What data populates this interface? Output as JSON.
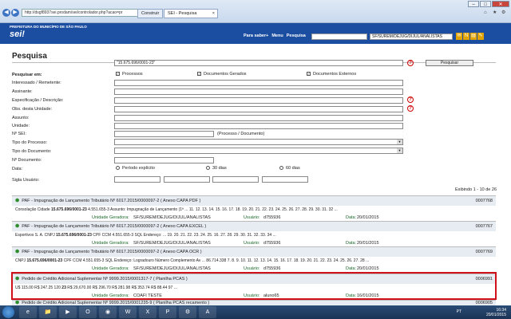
{
  "browser": {
    "url": "http://dsgf8937sei.prodam/sei/controlador.php?acao=pr",
    "tab1": "Construir",
    "tab2": "SEI - Pesquisa",
    "tab_close": "×",
    "back_glyph": "◀",
    "fwd_glyph": "▶",
    "home_glyph": "⌂",
    "star_glyph": "★",
    "gear_glyph": "⚙",
    "min": "–",
    "max": "□",
    "close": "✕"
  },
  "header": {
    "prefeitura": "PREFEITURA DO MUNICÍPIO DE SÃO PAULO",
    "logo": "sei!",
    "para_saber": "Para saber+",
    "menu": "Menu",
    "pesquisa": "Pesquisa",
    "unit": "SF/SUREM/DEJUG/DIJUL/ANALISTAS",
    "icons": [
      "✉",
      "N",
      "▤",
      "✎"
    ]
  },
  "page": {
    "title": "Pesquisa",
    "search_value": "\"15.675.696/0001-23\"",
    "search_button": "Pesquisar",
    "help": "?",
    "check": "✓"
  },
  "form": {
    "pesquisar_em": "Pesquisar em:",
    "processos": "Processos",
    "docs_gerados": "Documentos Gerados",
    "docs_externos": "Documentos Externos",
    "interessado": "Interessado / Remetente:",
    "assinante": "Assinante:",
    "especificacao": "Especificação / Descrição:",
    "obs": "Obs. desta Unidade:",
    "assunto": "Assunto:",
    "unidade": "Unidade:",
    "nsei": "Nº SEI:",
    "nsei_hint": "(Processo / Documento)",
    "tipo_processo": "Tipo do Processo:",
    "tipo_documento": "Tipo do Documento:",
    "ndocumento": "Nº Documento:",
    "data": "Data:",
    "periodo": "Período explícito",
    "d30": "30 dias",
    "d60": "60 dias",
    "sigla": "Sigla Usuário:"
  },
  "results": {
    "count": "Exibindo 1 - 10 de 26",
    "unidade_label": "Unidade Geradora:",
    "usuario_label": "Usuário:",
    "data_label": "Data:",
    "items": [
      {
        "title": "PAF - Impugnação de Lançamento Tributário Nº 6017.2015/0000097-2 ( Anexo CAPA PDF )",
        "num": "0007768",
        "desc_pre": "Consolação Cidade ",
        "desc_key": "15.675.696/0001-23",
        "desc_post": " 4.551.655-3 Assunto: Impugnação de Lançamento (1ª ... 11. 12. 13. 14. 15. 16. 17. 18. 19. 20. 21. 22. 23. 24. 25. 26. 27. 28. 29. 30. 31. 32 ...",
        "unidade": "SF/SUREM/DEJUG/DIJUL/ANALISTAS",
        "usuario": "d755936",
        "data": "20/01/2015"
      },
      {
        "title": "PAF - Impugnação de Lançamento Tributário Nº 6017.2015/0000097-2 ( Anexo CAPA EXCEL )",
        "num": "0007767",
        "desc_pre": "Esportivos S. A. CNPJ ",
        "desc_key": "15.675.696/0001-23",
        "desc_post": " CPF CCM 4.551.655-3 SQL Endereço: ... 19. 20. 21. 22. 23. 24. 25. 16. 27. 28. 29. 30. 31. 32. 33. 34 ...",
        "unidade": "SF/SUREM/DEJUG/DIJUL/ANALISTAS",
        "usuario": "d755936",
        "data": "20/01/2015"
      },
      {
        "title": "PAF - Impugnação de Lançamento Tributário Nº 6017.2015/0000097-2 ( Anexo CAPA OCR )",
        "num": "0007769",
        "desc_pre": "CNPJ ",
        "desc_key": "15.675.696/0001-23",
        "desc_post": " CPF CCM 4.551.655-3 SQL Endereço: Logradouro Número Complemento Av ... 86.714.338 7. 8. 9. 10. 11. 12. 13. 14. 15. 16. 17. 18. 19. 20. 21. 22. 23. 24. 25. 26. 27. 28 ...",
        "unidade": "SF/SUREM/DEJUG/DIJUL/ANALISTAS",
        "usuario": "d755936",
        "data": "20/01/2015"
      },
      {
        "title": "Pedido de Crédito Adicional Suplementar Nº 9999.2015/0001317-7 ( Planilha PCAS )",
        "num": "0006991",
        "desc_pre": "U$ 115.00 R$ 247.25 120 ",
        "desc_key": "23",
        "desc_post": " R$ 29,670.00 R$ 296.70 R$ 281.98 R$ 353.74 R$ 88.44 97 ...",
        "unidade": "COAFI TESTE",
        "usuario": "aluno65",
        "data": "16/01/2015"
      }
    ],
    "partial_title": "Pedido de Crédito Adicional Suplementar Nº 9999.2015/0001235-9 ( Planilha PCAS recamento )",
    "partial_num": "0006905"
  },
  "taskbar": {
    "apps": [
      "e",
      "📁",
      "▶",
      "O",
      "◉",
      "W",
      "X",
      "P",
      "⚙",
      "A"
    ],
    "lang": "PT",
    "time": "16:34",
    "date": "20/01/2015"
  }
}
